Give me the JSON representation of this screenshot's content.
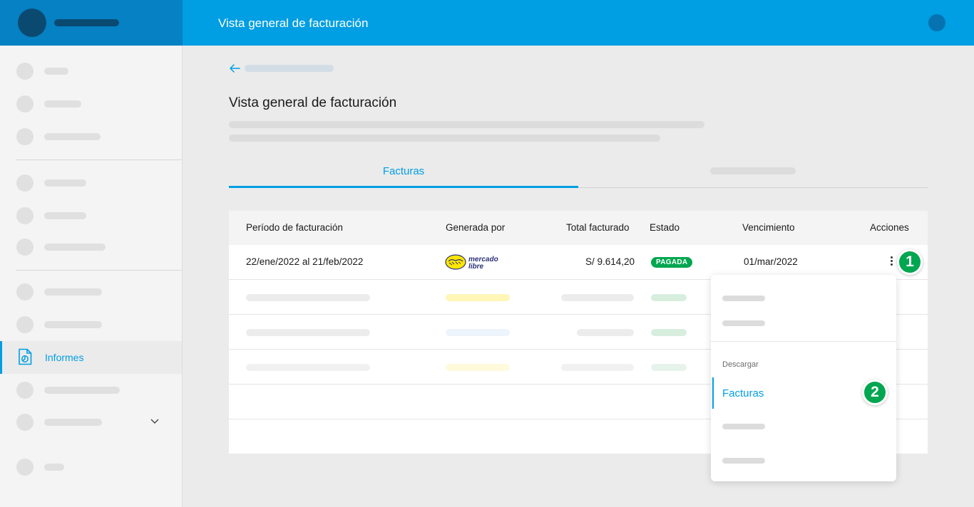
{
  "header": {
    "title": "Vista general de facturación"
  },
  "sidebar": {
    "active_item": {
      "label": "Informes",
      "icon": "report-document-icon"
    }
  },
  "main": {
    "title": "Vista general de facturación",
    "tabs": [
      {
        "label": "Facturas",
        "active": true
      }
    ]
  },
  "table": {
    "columns": [
      "Período de facturación",
      "Generada por",
      "Total facturado",
      "Estado",
      "Vencimiento",
      "Acciones"
    ],
    "rows": [
      {
        "period": "22/ene/2022 al 21/feb/2022",
        "generated_by_logo": "Mercado Libre",
        "total": "S/ 9.614,20",
        "status": "PAGADA",
        "due": "01/mar/2022"
      }
    ]
  },
  "actions_menu": {
    "section_label": "Descargar",
    "selected_item": "Facturas"
  },
  "steps": [
    "1",
    "2"
  ],
  "colors": {
    "brand_blue": "#009ee3",
    "brand_dark": "#0681c3",
    "status_paid": "#00a650",
    "step_badge": "#00a650"
  }
}
